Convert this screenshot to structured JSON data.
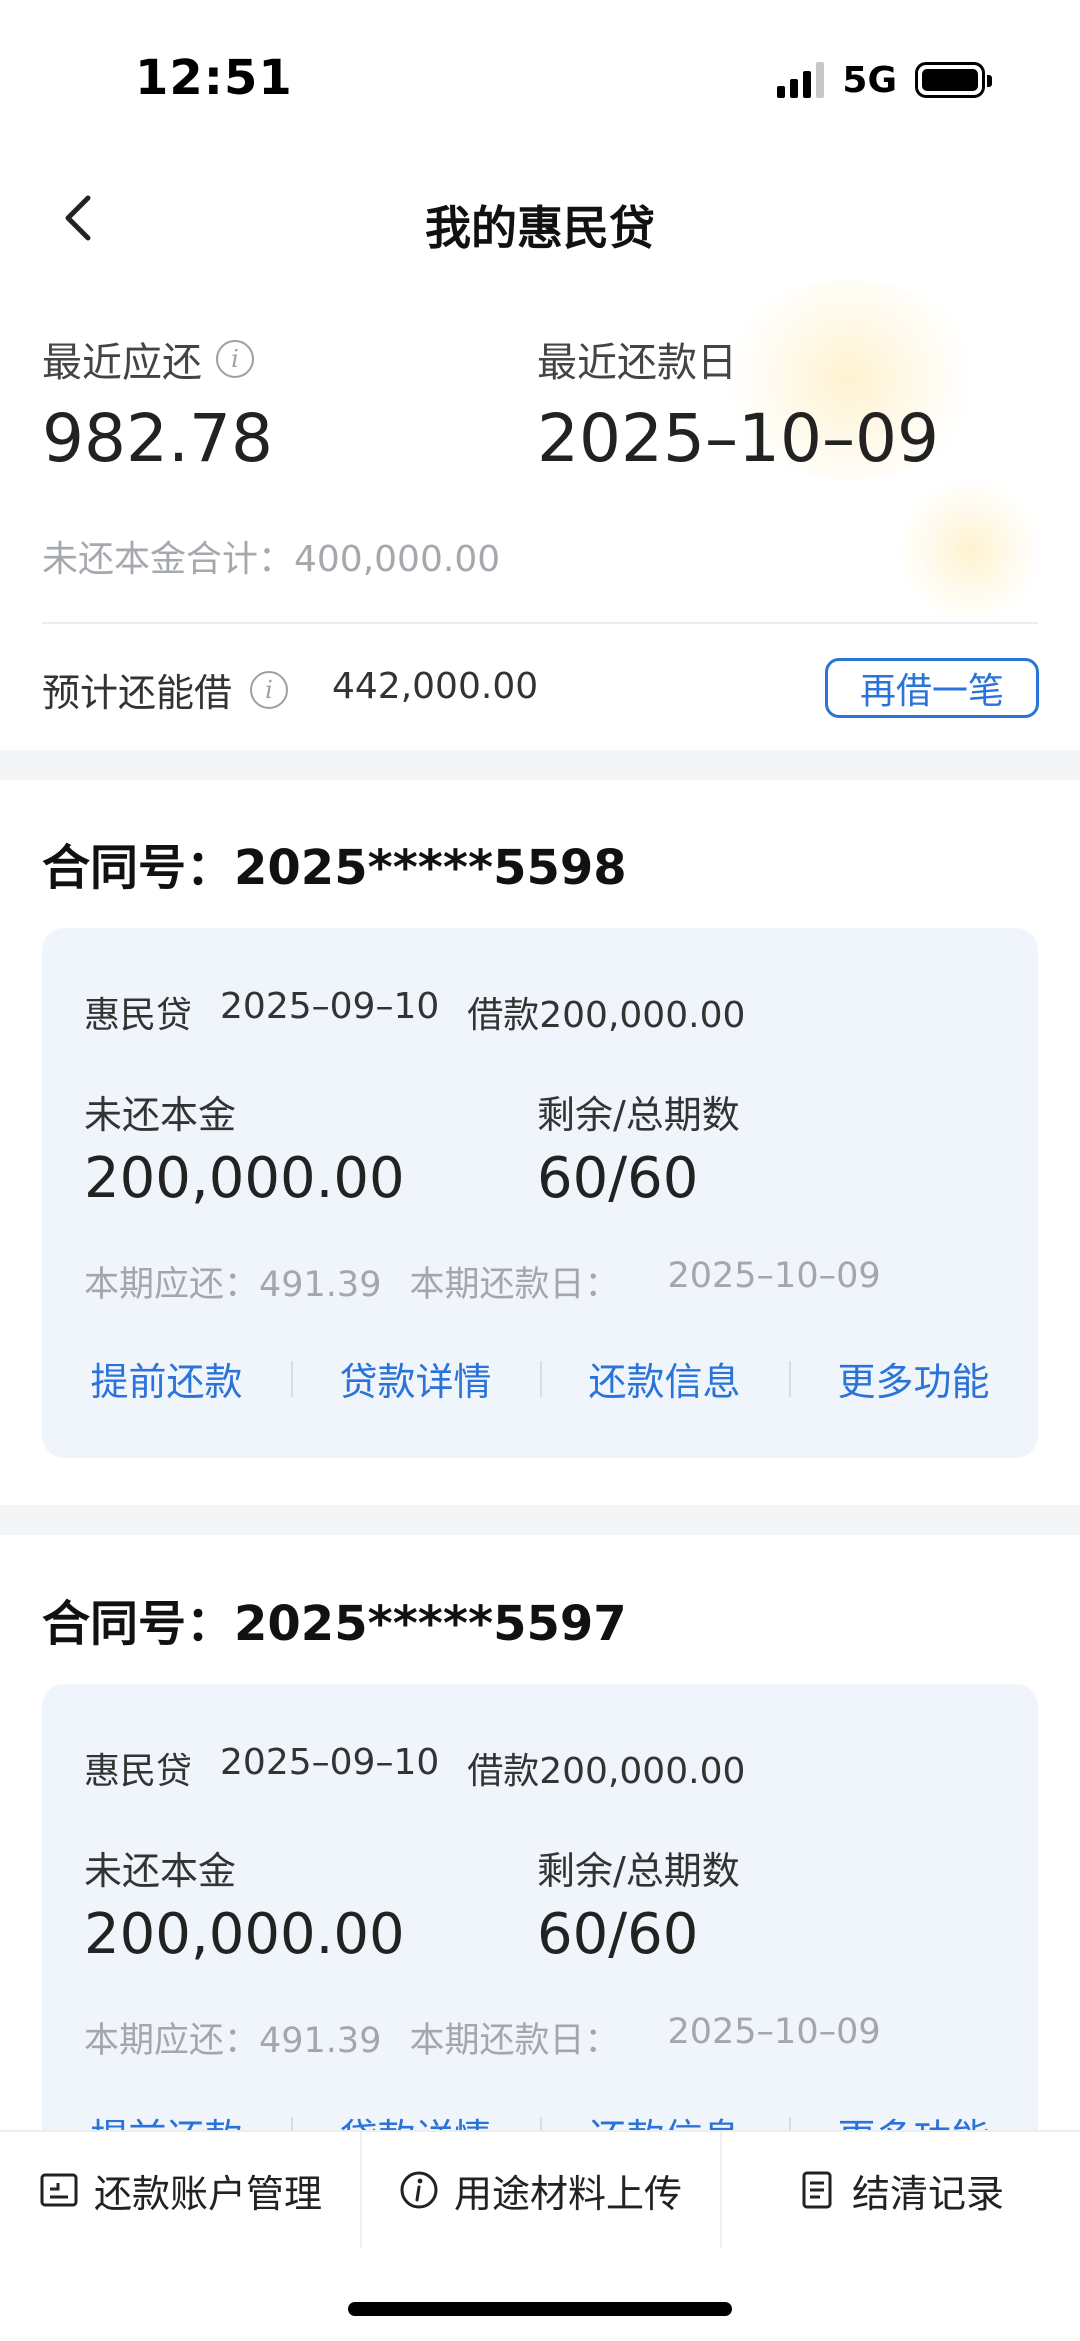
{
  "status_bar": {
    "time": "12:51",
    "network": "5G"
  },
  "nav": {
    "title": "我的惠民贷"
  },
  "summary": {
    "due_label": "最近应还",
    "due_value": "982.78",
    "due_date_label": "最近还款日",
    "due_date_value": "2025–10–09",
    "principal_total": "未还本金合计：400,000.00",
    "borrow_label": "预计还能借",
    "borrow_value": "442,000.00",
    "borrow_button": "再借一笔"
  },
  "contracts": [
    {
      "title": "合同号：2025*****5598",
      "product": "惠民贷",
      "date": "2025–09–10",
      "loan": "借款200,000.00",
      "principal_label": "未还本金",
      "principal_value": "200,000.00",
      "periods_label": "剩余/总期数",
      "periods_value": "60/60",
      "due_text": "本期应还：491.39",
      "due_date_label": "本期还款日：",
      "due_date": "2025–10–09",
      "actions": [
        "提前还款",
        "贷款详情",
        "还款信息",
        "更多功能"
      ]
    },
    {
      "title": "合同号：2025*****5597",
      "product": "惠民贷",
      "date": "2025–09–10",
      "loan": "借款200,000.00",
      "principal_label": "未还本金",
      "principal_value": "200,000.00",
      "periods_label": "剩余/总期数",
      "periods_value": "60/60",
      "due_text": "本期应还：491.39",
      "due_date_label": "本期还款日：",
      "due_date": "2025–10–09",
      "actions": [
        "提前还款",
        "贷款详情",
        "还款信息",
        "更多功能"
      ]
    }
  ],
  "bottom_tabs": [
    {
      "label": "还款账户管理",
      "icon": "account-icon"
    },
    {
      "label": "用途材料上传",
      "icon": "info-icon"
    },
    {
      "label": "结清记录",
      "icon": "document-icon"
    }
  ],
  "colors": {
    "accent": "#2a73d9",
    "card_bg": "#f0f5fc",
    "muted": "#a5a9ae"
  }
}
